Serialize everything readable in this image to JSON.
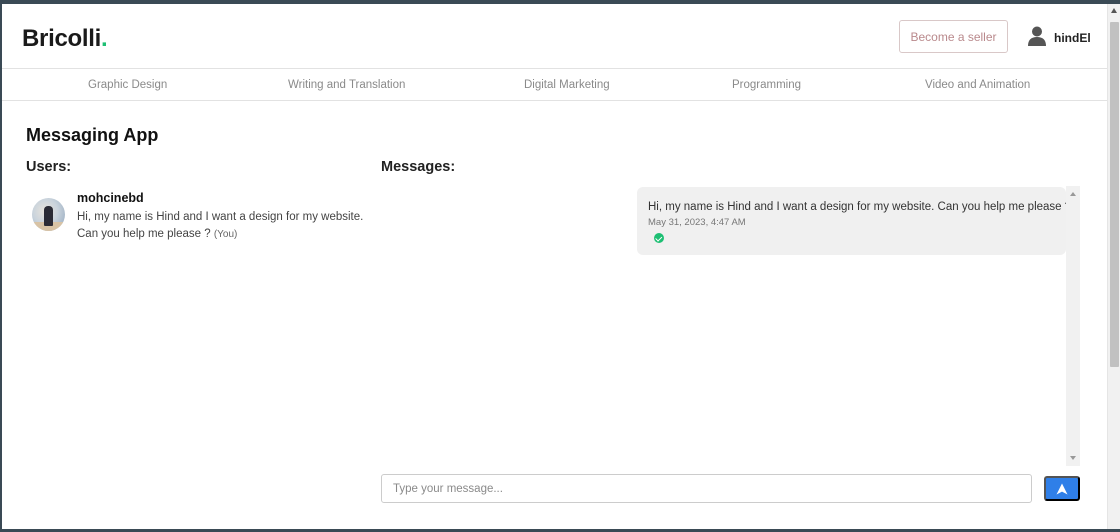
{
  "header": {
    "logo_text": "Bricolli",
    "logo_dot": ".",
    "seller_button": "Become a seller",
    "username": "hindEl",
    "user_icon": "user-icon"
  },
  "categories": [
    "Graphic Design",
    "Writing and Translation",
    "Digital Marketing",
    "Programming",
    "Video and Animation"
  ],
  "page": {
    "title": "Messaging App",
    "users_heading": "Users:",
    "messages_heading": "Messages:"
  },
  "users": [
    {
      "name": "mohcinebd",
      "preview": "Hi, my name is Hind and I want a design for my website. Can you help me please ?",
      "you_tag": "(You)"
    }
  ],
  "messages": [
    {
      "text": "Hi, my name is Hind and I want a design for my website. Can you help me please ?",
      "timestamp": "May 31, 2023, 4:47 AM",
      "status_icon": "check-circle-icon"
    }
  ],
  "composer": {
    "placeholder": "Type your message...",
    "send_icon": "send-icon"
  },
  "colors": {
    "brand_green": "#1dbf73",
    "send_blue": "#2f7fe8",
    "seller_text": "#b9898c"
  }
}
